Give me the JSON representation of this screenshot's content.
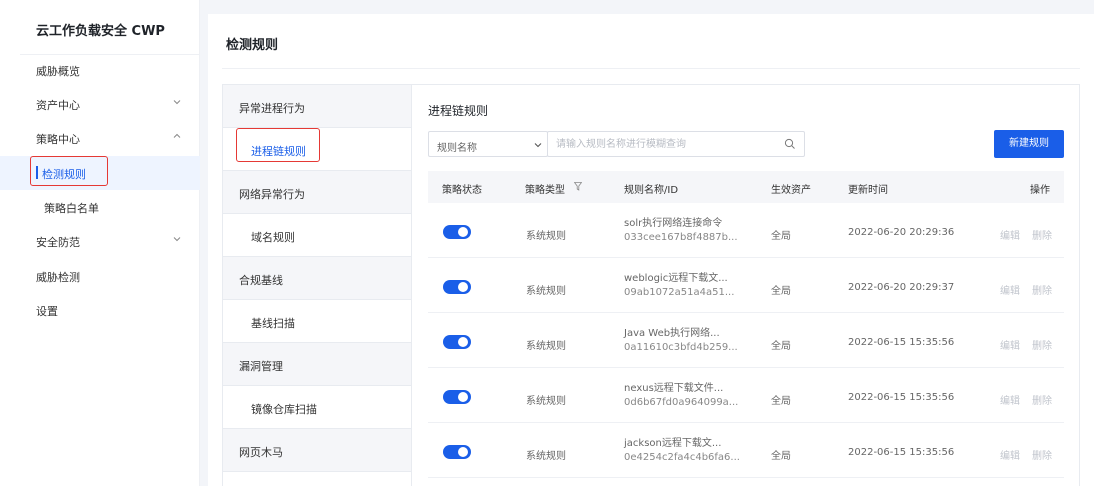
{
  "app": {
    "title": "云工作负载安全 CWP"
  },
  "sidebar": {
    "items": [
      {
        "label": "威胁概览"
      },
      {
        "label": "资产中心"
      },
      {
        "label": "策略中心"
      },
      {
        "label": "检测规则"
      },
      {
        "label": "策略白名单"
      },
      {
        "label": "安全防范"
      },
      {
        "label": "威胁检测"
      },
      {
        "label": "设置"
      }
    ]
  },
  "page": {
    "title": "检测规则"
  },
  "categories": [
    {
      "label": "异常进程行为"
    },
    {
      "label": "进程链规则"
    },
    {
      "label": "网络异常行为"
    },
    {
      "label": "域名规则"
    },
    {
      "label": "合规基线"
    },
    {
      "label": "基线扫描"
    },
    {
      "label": "漏洞管理"
    },
    {
      "label": "镜像仓库扫描"
    },
    {
      "label": "网页木马"
    }
  ],
  "content": {
    "title": "进程链规则",
    "filter_select": "规则名称",
    "search_placeholder": "请输入规则名称进行模糊查询",
    "new_button": "新建规则",
    "columns": {
      "status": "策略状态",
      "type": "策略类型",
      "name": "规则名称/ID",
      "asset": "生效资产",
      "updated": "更新时间",
      "ops": "操作"
    },
    "rows": [
      {
        "type": "系统规则",
        "name": "solr执行网络连接命令",
        "id": "033cee167b8f4887b...",
        "asset": "全局",
        "updated": "2022-06-20 20:29:36",
        "edit": "编辑",
        "delete": "删除"
      },
      {
        "type": "系统规则",
        "name": "weblogic远程下载文...",
        "id": "09ab1072a51a4a51...",
        "asset": "全局",
        "updated": "2022-06-20 20:29:37",
        "edit": "编辑",
        "delete": "删除"
      },
      {
        "type": "系统规则",
        "name": "Java Web执行网络...",
        "id": "0a11610c3bfd4b259...",
        "asset": "全局",
        "updated": "2022-06-15 15:35:56",
        "edit": "编辑",
        "delete": "删除"
      },
      {
        "type": "系统规则",
        "name": "nexus远程下载文件...",
        "id": "0d6b67fd0a964099a...",
        "asset": "全局",
        "updated": "2022-06-15 15:35:56",
        "edit": "编辑",
        "delete": "删除"
      },
      {
        "type": "系统规则",
        "name": "jackson远程下载文...",
        "id": "0e4254c2fa4c4b6fa6...",
        "asset": "全局",
        "updated": "2022-06-15 15:35:56",
        "edit": "编辑",
        "delete": "删除"
      }
    ]
  },
  "colors": {
    "primary": "#1a5ee8",
    "highlight": "#e53935"
  },
  "icons": {
    "chevron_down": "chevron-down-icon",
    "chevron_up": "chevron-up-icon",
    "search": "search-icon",
    "filter": "filter-icon"
  }
}
